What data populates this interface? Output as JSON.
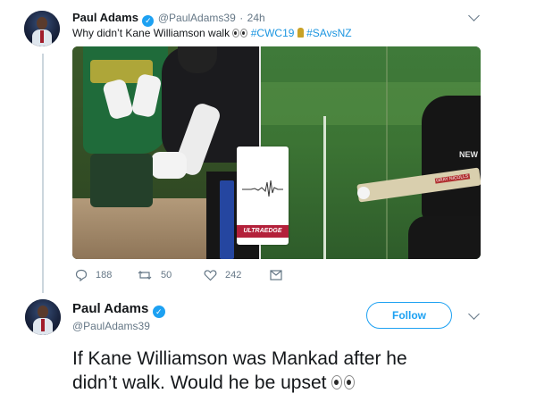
{
  "main_tweet": {
    "display_name": "Paul Adams",
    "handle": "@PaulAdams39",
    "separator": "·",
    "time": "24h",
    "text_prefix": "Why didn’t Kane Williamson walk",
    "hashtag1": "#CWC19",
    "hashtag2": "#SAvsNZ",
    "media": {
      "ultraedge_label": "ULTRAEDGE",
      "shirt_text": "NEW",
      "bat_sticker": "GRAY NICOLLS"
    },
    "actions": {
      "replies": "188",
      "retweets": "50",
      "likes": "242"
    }
  },
  "quoted_tweet": {
    "display_name": "Paul Adams",
    "handle": "@PaulAdams39",
    "follow_label": "Follow",
    "text_line1": "If Kane Williamson was Mankad after he",
    "text_line2": "didn’t walk. Would he be upset"
  },
  "colors": {
    "accent": "#1da1f2",
    "hashtag": "#1b95e0",
    "muted": "#657786",
    "text": "#14171a"
  }
}
